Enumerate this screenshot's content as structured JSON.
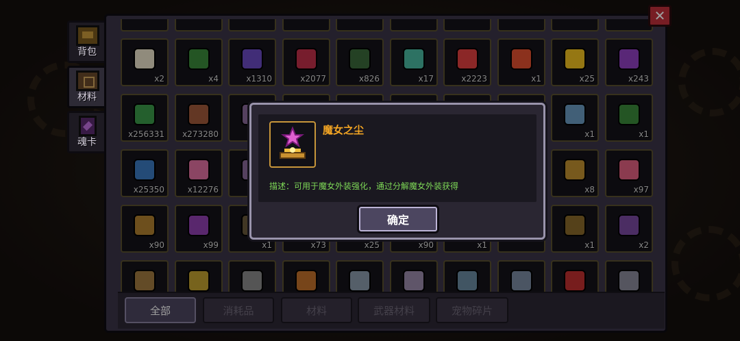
{
  "side_tabs": [
    {
      "label": "背包",
      "icon": "chest-icon",
      "active": false
    },
    {
      "label": "材料",
      "icon": "materials-icon",
      "active": true
    },
    {
      "label": "魂卡",
      "icon": "soul-card-icon",
      "active": false
    }
  ],
  "close_label": "✕",
  "grid": {
    "rows": [
      {
        "cells": [
          {
            "count": "x2",
            "icon": "chef-figure-icon",
            "color": "#e8e0c8"
          },
          {
            "count": "x4",
            "icon": "green-helmet-figure-icon",
            "color": "#3a8a3a"
          },
          {
            "count": "x1310",
            "icon": "purple-shield-icon",
            "color": "#6a4ac0"
          },
          {
            "count": "x2077",
            "icon": "medal-icon",
            "color": "#c0304a"
          },
          {
            "count": "x826",
            "icon": "gear-icon",
            "color": "#3a6a3a"
          },
          {
            "count": "x17",
            "icon": "crystal-cone-icon",
            "color": "#4ab8a0"
          },
          {
            "count": "x2223",
            "icon": "colored-cubes-icon",
            "color": "#e04040"
          },
          {
            "count": "x1",
            "icon": "heart-icon",
            "color": "#e05030"
          },
          {
            "count": "x25",
            "icon": "smiley-face-icon",
            "color": "#f0c020"
          },
          {
            "count": "x243",
            "icon": "purple-demon-icon",
            "color": "#9040c0"
          }
        ]
      },
      {
        "cells": [
          {
            "count": "x256331",
            "icon": "green-orb-icon",
            "color": "#3a9a4a"
          },
          {
            "count": "x273280",
            "icon": "leather-hide-icon",
            "color": "#a05a3a"
          },
          {
            "count": "",
            "icon": "item-icon",
            "color": "#8a6a9a"
          },
          {
            "count": "",
            "icon": "item-icon",
            "color": "#555"
          },
          {
            "count": "",
            "icon": "item-icon",
            "color": "#555"
          },
          {
            "count": "",
            "icon": "item-icon",
            "color": "#555"
          },
          {
            "count": "",
            "icon": "item-icon",
            "color": "#555"
          },
          {
            "count": "",
            "icon": "item-icon",
            "color": "#555"
          },
          {
            "count": "x1",
            "icon": "blue-disc-icon",
            "color": "#6a9ac0"
          },
          {
            "count": "x1",
            "icon": "green-potion-icon",
            "color": "#3a8a3a"
          }
        ]
      },
      {
        "cells": [
          {
            "count": "x25350",
            "icon": "blue-gem-icon",
            "color": "#3a7ac0"
          },
          {
            "count": "x12276",
            "icon": "pink-crystal-cluster-icon",
            "color": "#e070a0"
          },
          {
            "count": "",
            "icon": "item-icon",
            "color": "#8a6a9a"
          },
          {
            "count": "",
            "icon": "item-icon",
            "color": "#555"
          },
          {
            "count": "",
            "icon": "item-icon",
            "color": "#555"
          },
          {
            "count": "",
            "icon": "item-icon",
            "color": "#555"
          },
          {
            "count": "",
            "icon": "item-icon",
            "color": "#555"
          },
          {
            "count": "",
            "icon": "item-icon",
            "color": "#555"
          },
          {
            "count": "x8",
            "icon": "star-medal-icon",
            "color": "#c09030"
          },
          {
            "count": "x97",
            "icon": "pink-feather-icon",
            "color": "#e06080"
          }
        ]
      },
      {
        "cells": [
          {
            "count": "x90",
            "icon": "bronze-star-icon",
            "color": "#b08030"
          },
          {
            "count": "x99",
            "icon": "energy-battery-icon",
            "color": "#9040b0"
          },
          {
            "count": "x1",
            "icon": "item-icon",
            "color": "#6a5a3a"
          },
          {
            "count": "x73",
            "icon": "item-icon",
            "color": "#555"
          },
          {
            "count": "x25",
            "icon": "item-icon",
            "color": "#555"
          },
          {
            "count": "x90",
            "icon": "item-icon",
            "color": "#555"
          },
          {
            "count": "x1",
            "icon": "item-icon",
            "color": "#555"
          },
          {
            "count": "",
            "icon": "item-icon",
            "color": "#555"
          },
          {
            "count": "x1",
            "icon": "green-blueprint-icon",
            "color": "#8a6a2a"
          },
          {
            "count": "x2",
            "icon": "purple-blueprint-icon",
            "color": "#7a4aa0"
          }
        ]
      },
      {
        "cells": [
          {
            "count": "",
            "icon": "bronze-frame-icon",
            "color": "#a07a40"
          },
          {
            "count": "",
            "icon": "gold-ore-icon",
            "color": "#c0a030"
          },
          {
            "count": "",
            "icon": "magnifier-icon",
            "color": "#8a8a8a"
          },
          {
            "count": "",
            "icon": "crystal-shards-icon",
            "color": "#c0702a"
          },
          {
            "count": "",
            "icon": "magnifier-icon",
            "color": "#8a9aaa"
          },
          {
            "count": "",
            "icon": "magnifier-icon",
            "color": "#9a8aaa"
          },
          {
            "count": "",
            "icon": "wrench-icon",
            "color": "#6a8aa0"
          },
          {
            "count": "",
            "icon": "pistol-icon",
            "color": "#7a8aa0"
          },
          {
            "count": "",
            "icon": "red-rocket-icon",
            "color": "#c03030"
          },
          {
            "count": "",
            "icon": "cylinder-icon",
            "color": "#8a8a9a"
          }
        ]
      }
    ]
  },
  "categories": [
    {
      "label": "全部",
      "active": true
    },
    {
      "label": "消耗品",
      "active": false
    },
    {
      "label": "材料",
      "active": false
    },
    {
      "label": "武器材料",
      "active": false
    },
    {
      "label": "宠物碎片",
      "active": false
    }
  ],
  "dialog": {
    "item_name": "魔女之尘",
    "item_icon": "witch-dust-icon",
    "description": "描述：可用于魔女外装强化，通过分解魔女外装获得",
    "confirm_label": "确定"
  }
}
